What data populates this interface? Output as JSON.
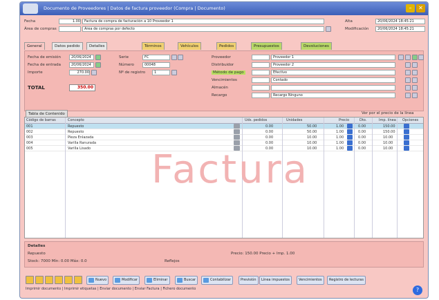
{
  "window": {
    "title": "Documento de Proveedores | Datos de factura proveedor (Compra | Documento)"
  },
  "header": {
    "fecha_label": "Fecha",
    "fecha_value": "1.00",
    "fecha_desc": "Factura de compra de facturación a 10 Proveedor 1",
    "area_label": "Área de compras",
    "area_value": "",
    "area_desc": "Área de compras por defecto",
    "alta_label": "Alta",
    "alta_value": "20/06/2024 18:45:21",
    "modif_label": "Modificación",
    "modif_value": "20/06/2024 18:45:21"
  },
  "tabs": [
    {
      "label": "General"
    },
    {
      "label": "Datos pedido"
    },
    {
      "label": "Detalles"
    },
    {
      "label": "Términos"
    },
    {
      "label": "Vehículos"
    },
    {
      "label": "Pedidos"
    },
    {
      "label": "Presupuestos"
    },
    {
      "label": "Devoluciones"
    }
  ],
  "general": {
    "fecha_emision_label": "Fecha de emisión",
    "fecha_emision_value": "20/06/2024",
    "fecha_entrada_label": "Fecha de entrada",
    "fecha_entrada_value": "20/06/2024",
    "importe_label": "Importe",
    "importe_value": "270.00",
    "total_label": "TOTAL",
    "total_value": "350.00",
    "serie_label": "Serie",
    "serie_value": "FC",
    "numero_label": "Número",
    "numero_value": "00048",
    "registro_label": "Nº de registro",
    "registro_value": "1",
    "proveedor_label": "Proveedor",
    "proveedor_value": "Proveedor 1",
    "distribuidor_label": "Distribuidor",
    "distribuidor_value": "Proveedor 2",
    "metodo_pago_label": "Método de pago",
    "metodo_pago_value": "Efectivo",
    "vencimientos_label": "Vencimientos",
    "vencimientos_value": "Contado",
    "almacen_label": "Almacén",
    "almacen_value": "",
    "recargo_label": "Recargo",
    "recargo_value": "Recargo Ninguno"
  },
  "grid": {
    "tab_label": "Tabla de Contenido",
    "option_label": "Ver por el precio de la línea",
    "columns": [
      "Código de barras",
      "Concepto",
      "Uds. pedidos",
      "Unidades",
      "Precio",
      "Dto.",
      "Imp. línea",
      "Opciones"
    ],
    "rows": [
      {
        "codigo": "001",
        "concepto": "Repuesto",
        "uds": "0.00",
        "unidades": "50.00",
        "precio": "1.00",
        "dto": "0.00",
        "importe": "150.00"
      },
      {
        "codigo": "002",
        "concepto": "Repuesto",
        "uds": "0.00",
        "unidades": "50.00",
        "precio": "1.00",
        "dto": "0.00",
        "importe": "150.00"
      },
      {
        "codigo": "003",
        "concepto": "Pieza Enlazada",
        "uds": "0.00",
        "unidades": "10.00",
        "precio": "1.00",
        "dto": "0.00",
        "importe": "10.00"
      },
      {
        "codigo": "004",
        "concepto": "Varilla Ranurada",
        "uds": "0.00",
        "unidades": "10.00",
        "precio": "1.00",
        "dto": "0.00",
        "importe": "10.00"
      },
      {
        "codigo": "005",
        "concepto": "Varilla Lisado",
        "uds": "0.00",
        "unidades": "10.00",
        "precio": "1.00",
        "dto": "0.00",
        "importe": "10.00"
      }
    ],
    "watermark": "Factura"
  },
  "bottom": {
    "detalles_label": "Detalles",
    "articulo_label": "Repuesto",
    "precio_info": "Precio: 150.00 Precio + Imp. 1.00",
    "stock_info": "Stock: 7000 Mín: 0.00 Máx: 0.0",
    "reflejos_label": "Reflejos"
  },
  "toolbar": {
    "buttons": [
      "Nuevo",
      "Modificar",
      "Eliminar",
      "Buscar",
      "Contabilizar",
      "Previsión",
      "Línea impuestos",
      "Vencimientos",
      "Registro de lecturas"
    ],
    "statusline": "Imprimir documento | Imprimir etiquetas | Enviar documento | Enviar Factura | Fichero documento"
  }
}
